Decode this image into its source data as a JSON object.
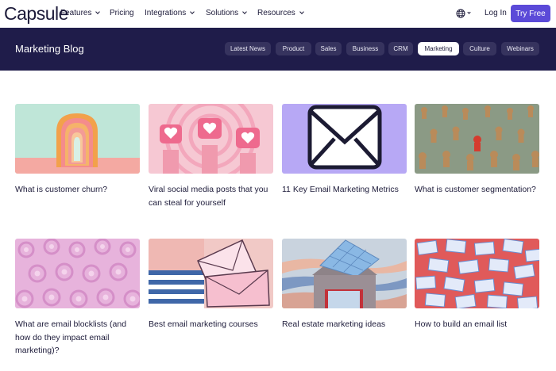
{
  "nav": {
    "logo": "Capsule",
    "items": [
      {
        "label": "Features",
        "dropdown": true
      },
      {
        "label": "Pricing",
        "dropdown": false
      },
      {
        "label": "Integrations",
        "dropdown": true
      },
      {
        "label": "Solutions",
        "dropdown": true
      },
      {
        "label": "Resources",
        "dropdown": true
      }
    ],
    "login": "Log In",
    "try_free": "Try Free"
  },
  "blog": {
    "title": "Marketing Blog",
    "categories": [
      "Latest News",
      "Product",
      "Sales",
      "Business",
      "CRM",
      "Marketing",
      "Culture",
      "Webinars"
    ],
    "active_category": "Marketing"
  },
  "posts": [
    {
      "title": "What is customer churn?",
      "image": "arch-tunnel"
    },
    {
      "title": "Viral social media posts that you can steal for yourself",
      "image": "heart-notifications"
    },
    {
      "title": "11 Key Email Marketing Metrics",
      "image": "envelope-icon"
    },
    {
      "title": "What is customer segmentation?",
      "image": "chess-pawns"
    },
    {
      "title": "What are email blocklists (and how do they impact email marketing)?",
      "image": "at-symbol-pattern"
    },
    {
      "title": "Best email marketing courses",
      "image": "pink-envelopes"
    },
    {
      "title": "Real estate marketing ideas",
      "image": "house-painting"
    },
    {
      "title": "How to build an email list",
      "image": "envelope-pattern"
    }
  ],
  "colors": {
    "brand": "#5b4ad8",
    "band": "#1f1c4a",
    "pill": "#36335e",
    "text": "#1d1b3a"
  }
}
